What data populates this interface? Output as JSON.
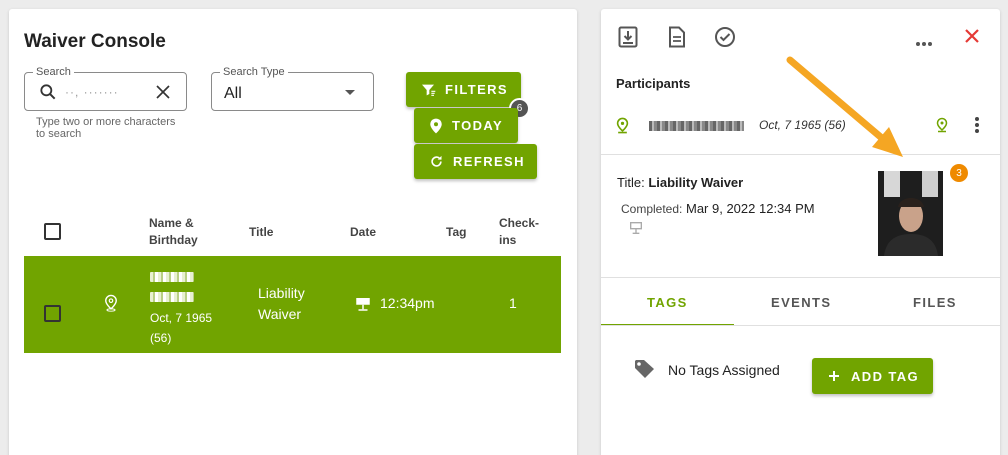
{
  "left": {
    "title": "Waiver Console",
    "search": {
      "label": "Search",
      "value": "··, ·······",
      "helper": "Type two or more characters to search"
    },
    "search_type": {
      "label": "Search Type",
      "value": "All"
    },
    "buttons": {
      "filters": "FILTERS",
      "filters_badge": "6",
      "today": "TODAY",
      "refresh": "REFRESH"
    },
    "table": {
      "columns": {
        "name": "Name & Birthday",
        "title": "Title",
        "date": "Date",
        "tag": "Tag",
        "checkins": "Check-ins"
      },
      "rows": [
        {
          "birthday": "Oct, 7 1965",
          "age": "(56)",
          "title": "Liability Waiver",
          "time": "12:34pm",
          "checkins": "1"
        }
      ]
    }
  },
  "right": {
    "participants_label": "Participants",
    "participant": {
      "birthday": "Oct, 7 1965 (56)"
    },
    "waiver": {
      "title_label": "Title:",
      "title_value": "Liability Waiver",
      "completed_label": "Completed:",
      "completed_value": "Mar 9, 2022 12:34 PM",
      "photo_badge": "3"
    },
    "tabs": [
      "TAGS",
      "EVENTS",
      "FILES"
    ],
    "no_tags": "No Tags Assigned",
    "add_tag": "ADD TAG"
  },
  "colors": {
    "accent": "#71a400",
    "badge_orange": "#ef8a00",
    "close_red": "#e53935",
    "arrow": "#f5a623"
  }
}
